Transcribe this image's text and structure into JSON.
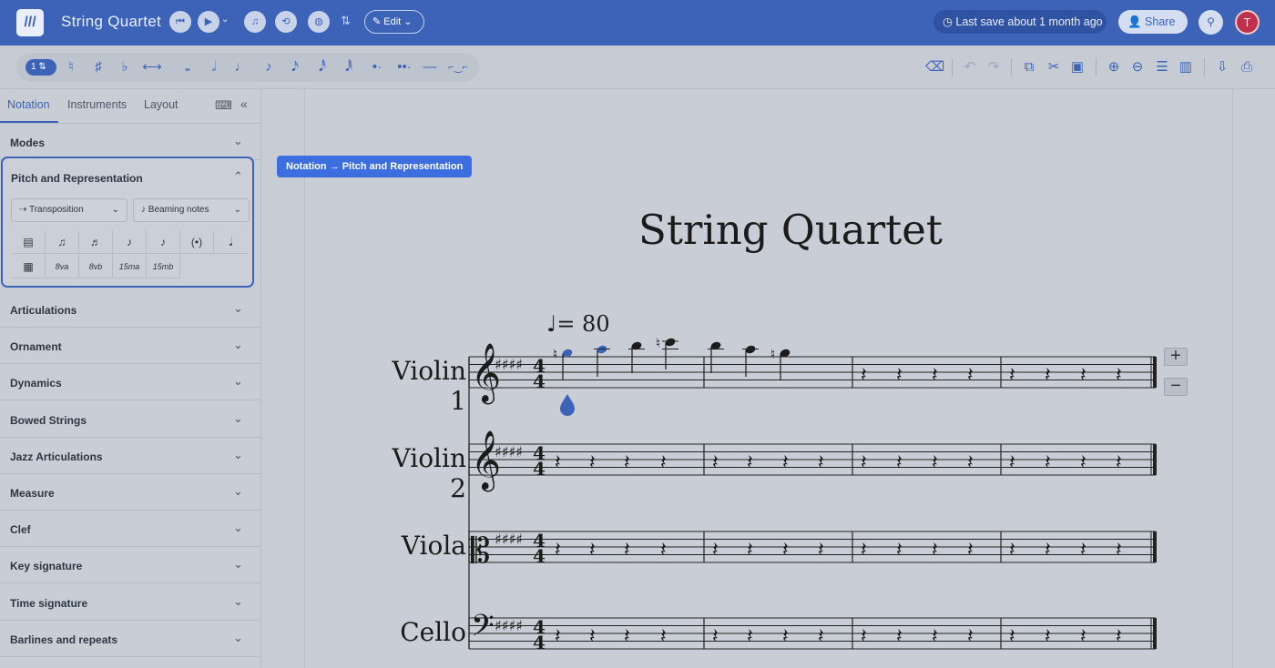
{
  "header": {
    "logo": "///",
    "title": "String Quartet",
    "edit_label": "Edit",
    "save_status": "Last save about 1 month ago",
    "share_label": "Share",
    "avatar_initial": "T"
  },
  "toolbar": {
    "voice": "1",
    "note_tools": [
      "♮",
      "♯",
      "♭",
      "⟷",
      "𝅝",
      "𝅗𝅥",
      "♩",
      "♪",
      "𝅘𝅥𝅯",
      "𝅘𝅥𝅰",
      "𝅘𝅥𝅱",
      "•·",
      "••·",
      "—",
      "⌐‿⌐"
    ],
    "right_tools": [
      "delete-icon",
      "undo-icon",
      "redo-icon",
      "copy-icon",
      "cut-icon",
      "paste-icon",
      "zoom-in-icon",
      "zoom-out-icon",
      "layout-icon",
      "flip-icon",
      "download-icon",
      "print-icon"
    ]
  },
  "sidebar": {
    "tabs": [
      "Notation",
      "Instruments",
      "Layout"
    ],
    "active_tab": "Notation",
    "sections": [
      "Modes",
      "Pitch and Representation",
      "Articulations",
      "Ornament",
      "Dynamics",
      "Bowed Strings",
      "Jazz Articulations",
      "Measure",
      "Clef",
      "Key signature",
      "Time signature",
      "Barlines and repeats"
    ],
    "pitch": {
      "transposition_label": "Transposition",
      "beaming_label": "Beaming notes",
      "row1": [
        "▤",
        "♫",
        "♬",
        "♪",
        "♪",
        "(•)",
        "𝅘𝅥"
      ],
      "row2": [
        "▦",
        "8va",
        "8vb",
        "15ma",
        "15mb"
      ]
    }
  },
  "score": {
    "breadcrumb": "Notation → Pitch and Representation",
    "title": "String Quartet",
    "tempo": "♩= 80",
    "instruments": [
      "Violin 1",
      "Violin 2",
      "Viola",
      "Cello"
    ],
    "time_signature": "4/4",
    "key": "E major (4 sharps)",
    "add_staff": "+",
    "remove_staff": "−"
  },
  "colors": {
    "accent": "#3d63b8",
    "header": "#3d63b8",
    "selected_note": "#3d63b8"
  }
}
